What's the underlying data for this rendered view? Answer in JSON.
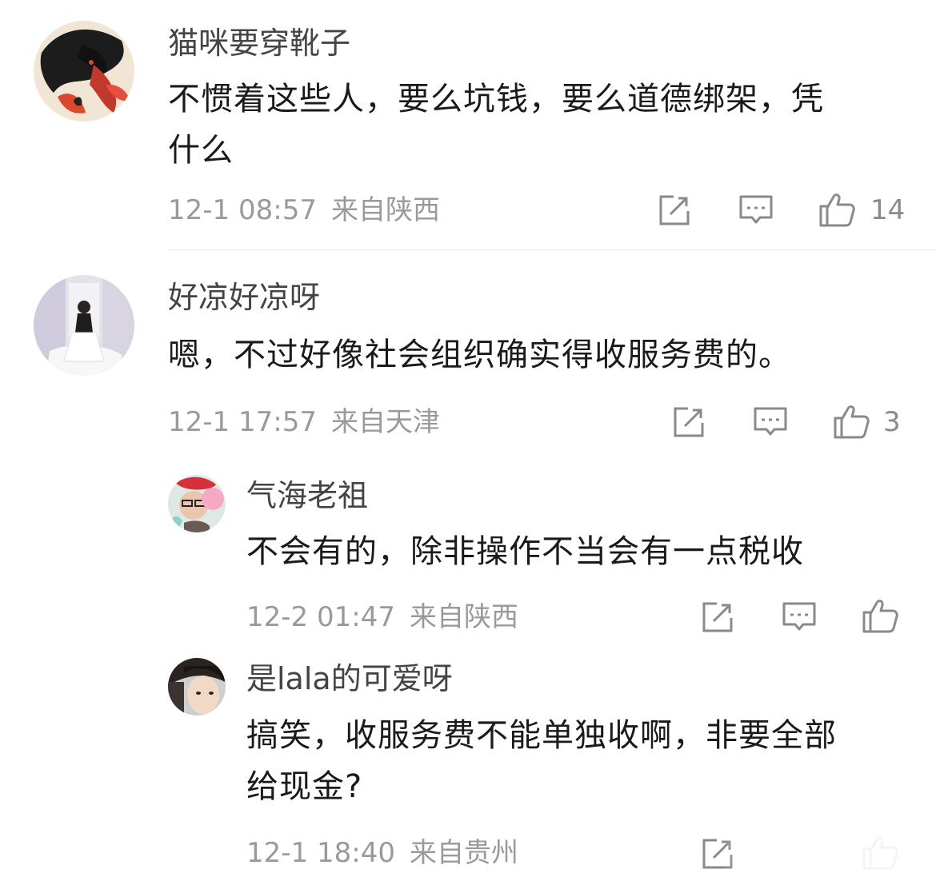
{
  "comments": [
    {
      "username": "猫咪要穿靴子",
      "text_line1": "不惯着这些人，要么坑钱，要么道德绑架，凭",
      "text_line2": "什么",
      "date": "12-1 08:57",
      "location": "来自陕西",
      "likes": "14"
    },
    {
      "username": "好凉好凉呀",
      "text": "嗯，不过好像社会组织确实得收服务费的。",
      "date": "12-1 17:57",
      "location": "来自天津",
      "likes": "3"
    }
  ],
  "replies": [
    {
      "username": "气海老祖",
      "text": "不会有的，除非操作不当会有一点税收",
      "date": "12-2 01:47",
      "location": "来自陕西"
    },
    {
      "username": "是lala的可爱呀",
      "text_line1": "搞笑，收服务费不能单独收啊，非要全部",
      "text_line2": "给现金?",
      "date": "12-1 18:40",
      "location": "来自贵州"
    }
  ],
  "icons": {
    "share": "share-icon",
    "reply": "comment-icon",
    "like": "thumbs-up-icon"
  },
  "colors": {
    "text": "#1a1a1a",
    "username": "#444444",
    "meta": "#9a9a9a",
    "icon": "#8a8a8a"
  }
}
